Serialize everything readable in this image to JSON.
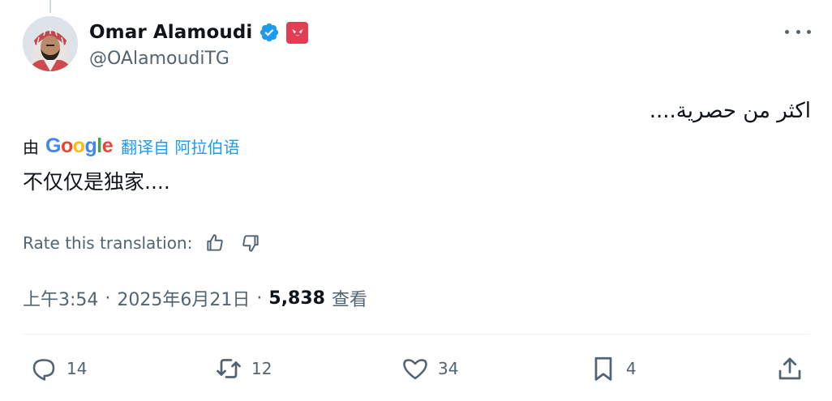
{
  "author": {
    "display_name": "Omar Alamoudi",
    "handle": "@OAlamoudiTG",
    "verified_color": "#1d9bf0",
    "affiliation_badge_color": "#e23d52"
  },
  "tweet": {
    "text": "اكثر من حصرية....",
    "translation": {
      "by_label": "由",
      "provider_letters": [
        "G",
        "o",
        "o",
        "g",
        "l",
        "e"
      ],
      "translated_from": "翻译自 阿拉伯语",
      "translated_text": "不仅仅是独家....",
      "rate_label": "Rate this translation:"
    },
    "time": "上午3:54",
    "date": "2025年6月21日",
    "separator": "·",
    "views_count": "5,838",
    "views_label": "查看"
  },
  "actions": {
    "replies": "14",
    "reposts": "12",
    "likes": "34",
    "bookmarks": "4"
  },
  "icons": {
    "more": "more-horizontal-icon",
    "reply": "speech-bubble-icon",
    "repost": "repost-arrows-icon",
    "like": "heart-icon",
    "bookmark": "bookmark-icon",
    "share": "share-upload-icon",
    "thumbs_up": "thumbs-up-icon",
    "thumbs_down": "thumbs-down-icon"
  }
}
